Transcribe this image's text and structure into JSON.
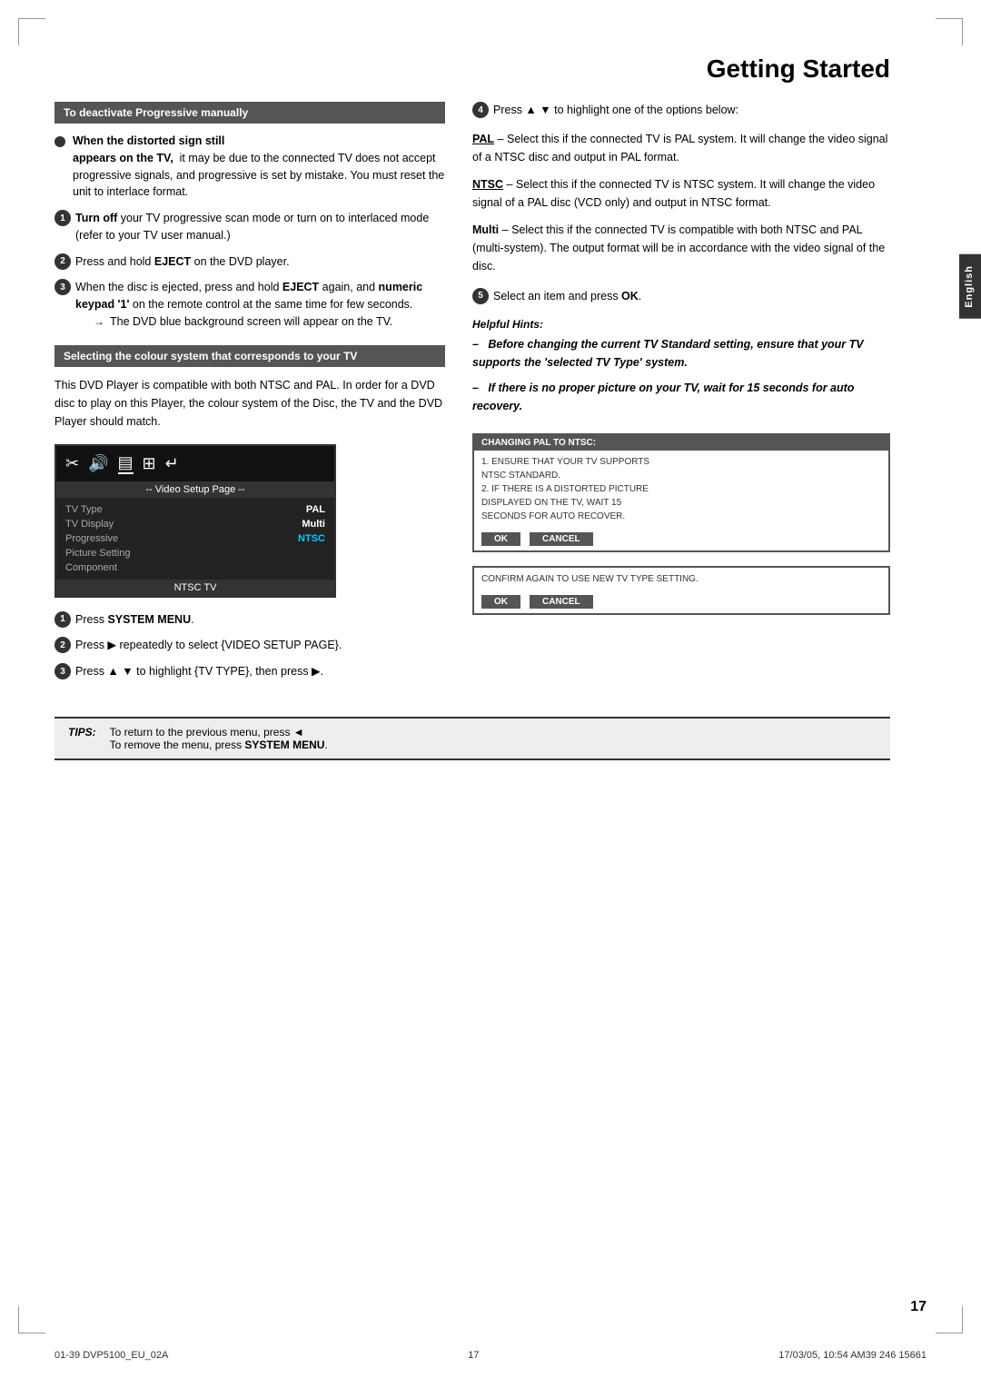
{
  "page": {
    "title": "Getting Started",
    "number": "17",
    "english_tab": "English"
  },
  "footer": {
    "left_text": "01-39 DVP5100_EU_02A",
    "center_text": "17",
    "right_text": "17/03/05, 10:54 AM39 246 15661"
  },
  "tips": {
    "label": "TIPS:",
    "line1": "To return to the previous menu, press ◄",
    "line2": "To remove the menu, press SYSTEM MENU"
  },
  "left_section": {
    "deactivate_box": {
      "title": "To deactivate Progressive manually"
    },
    "bullet1": {
      "bold_start": "When the distorted sign still",
      "text": "appears on the TV,  it may be due to the connected TV does not accept progressive signals, and progressive is set by mistake. You must reset the unit to interlace format."
    },
    "step1": {
      "number": "1",
      "text": "Turn off your TV progressive scan mode or turn on to interlaced mode (refer to your TV user manual.)"
    },
    "step2": {
      "number": "2",
      "text": "Press and hold EJECT on the DVD player."
    },
    "step3_prefix": "3",
    "step3_text": "When the disc is ejected, press and hold",
    "step3_bold": "EJECT",
    "step3_mid": " again, and ",
    "step3_bold2": "numeric keypad '1'",
    "step3_suffix": " on the remote control at the same time for few seconds.",
    "arrow_text": "The DVD blue background screen will appear on the TV.",
    "selecting_box": {
      "title": "Selecting the colour system that corresponds to your TV"
    },
    "selecting_text": "This DVD Player is compatible with both NTSC and PAL. In order for a DVD disc to play on this Player, the colour system of the Disc, the TV and the DVD Player should match.",
    "dvd_menu": {
      "header": "-- Video Setup Page --",
      "rows": [
        {
          "label": "TV Type",
          "value": "PAL"
        },
        {
          "label": "TV Display",
          "value": "Multi"
        },
        {
          "label": "Progressive",
          "value": "NTSC"
        },
        {
          "label": "Picture Setting",
          "value": ""
        },
        {
          "label": "Component",
          "value": ""
        }
      ],
      "footer": "NTSC TV"
    },
    "press1": {
      "number": "1",
      "text": "Press SYSTEM MENU."
    },
    "press2": {
      "number": "2",
      "text": "Press ▶ repeatedly to select {VIDEO SETUP PAGE}."
    },
    "press3": {
      "number": "3",
      "text": "Press ▲ ▼ to highlight {TV TYPE}, then press ▶."
    }
  },
  "right_section": {
    "step4_text": "Press ▲ ▼ to highlight one of the options below:",
    "pal_title": "PAL",
    "pal_text": "– Select this if the connected TV is PAL system. It will change the video signal of a NTSC disc and output in PAL format.",
    "ntsc_title": "NTSC",
    "ntsc_text": "– Select this if the connected TV is NTSC system. It will change the video signal of a PAL disc (VCD only) and output in NTSC format.",
    "multi_title": "Multi",
    "multi_text": "– Select this if the connected TV is compatible with both NTSC and PAL (multi-system). The output format will be in accordance with the video signal of the disc.",
    "step5_text": "Select an item and press OK.",
    "hints_title": "Helpful Hints:",
    "hint1": "–   Before changing the current TV Standard setting, ensure that your TV supports the 'selected TV Type' system.",
    "hint2": "–   If there is no proper picture on your TV, wait for 15 seconds for auto recovery.",
    "info_box1": {
      "header": "CHANGING PAL TO NTSC:",
      "line1": "1. ENSURE THAT YOUR TV SUPPORTS",
      "line2": "NTSC STANDARD.",
      "line3": "2. IF THERE IS A DISTORTED PICTURE",
      "line4": "DISPLAYED ON THE TV, WAIT 15",
      "line5": "SECONDS FOR AUTO RECOVER.",
      "ok_label": "OK",
      "cancel_label": "CANCEL"
    },
    "info_box2": {
      "header": "CONFIRM AGAIN TO USE NEW TV TYPE SETTING.",
      "ok_label": "OK",
      "cancel_label": "CANCEL"
    }
  }
}
